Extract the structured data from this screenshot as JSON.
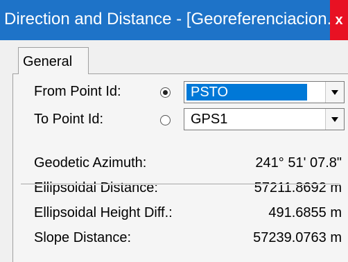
{
  "window": {
    "title": "Direction and Distance - [Georeferenciacion...",
    "close_glyph": "x"
  },
  "tabs": [
    {
      "label": "General"
    }
  ],
  "from_point": {
    "label": "From Point Id:",
    "selected": true,
    "value": "PSTO"
  },
  "to_point": {
    "label": "To Point Id:",
    "selected": false,
    "value": "GPS1"
  },
  "results": [
    {
      "label": "Geodetic Azimuth:",
      "value": "241° 51' 07.8\""
    },
    {
      "label": "Ellipsoidal Distance:",
      "value": "57211.8692 m"
    },
    {
      "label": "Ellipsoidal Height Diff.:",
      "value": "491.6855 m"
    },
    {
      "label": "Slope Distance:",
      "value": "57239.0763 m"
    }
  ],
  "colors": {
    "titlebar": "#1e73c8",
    "close": "#e81123",
    "selection": "#0078d7"
  }
}
